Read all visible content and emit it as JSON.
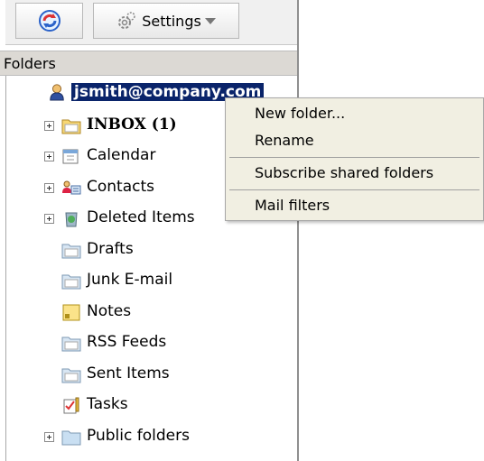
{
  "toolbar": {
    "refresh_icon": "refresh-icon",
    "settings_label": "Settings"
  },
  "folders_header": "Folders",
  "account": {
    "email": "jsmith@company.com",
    "icon": "user-icon"
  },
  "folders": [
    {
      "label": "INBOX (1)",
      "bold": true,
      "expandable": true,
      "icon": "folder-icon"
    },
    {
      "label": "Calendar",
      "expandable": true,
      "icon": "calendar-icon"
    },
    {
      "label": "Contacts",
      "expandable": true,
      "icon": "contacts-icon"
    },
    {
      "label": "Deleted Items",
      "expandable": true,
      "icon": "recycle-bin-icon"
    },
    {
      "label": "Drafts",
      "expandable": false,
      "icon": "folder-icon"
    },
    {
      "label": "Junk E-mail",
      "expandable": false,
      "icon": "folder-icon"
    },
    {
      "label": "Notes",
      "expandable": false,
      "icon": "notes-icon"
    },
    {
      "label": "RSS Feeds",
      "expandable": false,
      "icon": "folder-icon"
    },
    {
      "label": "Sent Items",
      "expandable": false,
      "icon": "folder-icon"
    },
    {
      "label": "Tasks",
      "expandable": false,
      "icon": "tasks-icon"
    },
    {
      "label": "Public folders",
      "expandable": true,
      "icon": "public-folder-icon"
    }
  ],
  "context_menu": {
    "items": [
      "New folder...",
      "Rename",
      "Subscribe shared folders",
      "Mail filters"
    ]
  },
  "colors": {
    "selection": "#0a246a",
    "menu_bg": "#f1efe2",
    "header_bg": "#dcd9d4"
  }
}
